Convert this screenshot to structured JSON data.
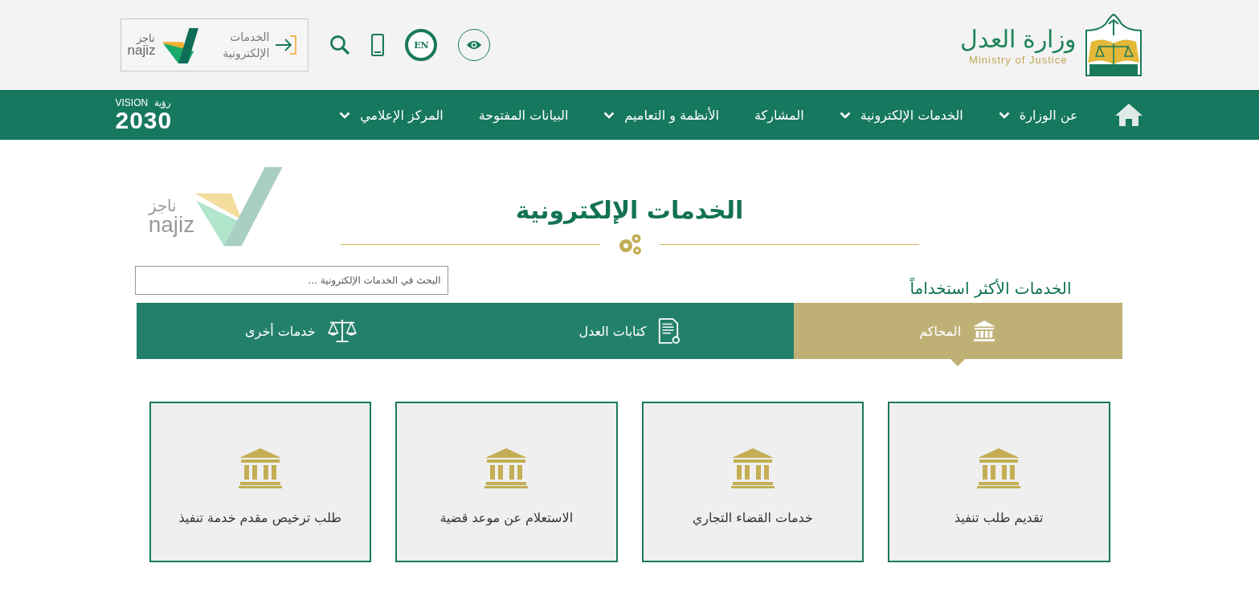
{
  "header": {
    "logo": {
      "arabic": "وزارة العدل",
      "english": "Ministry of Justice"
    },
    "language_button": {
      "label": "EN"
    },
    "najiz_link": {
      "label": "الخدمات الإلكترونية",
      "brand_arabic": "ناجز",
      "brand_latin": "najiz"
    }
  },
  "nav": {
    "items": [
      {
        "label": "عن الوزارة",
        "dropdown": true
      },
      {
        "label": "الخدمات الإلكترونية",
        "dropdown": true
      },
      {
        "label": "المشاركة",
        "dropdown": false
      },
      {
        "label": "الأنظمة و التعاميم",
        "dropdown": true
      },
      {
        "label": "البيانات المفتوحة",
        "dropdown": false
      },
      {
        "label": "المركز الإعلامي",
        "dropdown": true
      }
    ],
    "vision": {
      "label": "VISION",
      "arabic": "رؤية",
      "year": "2030"
    }
  },
  "hero": {
    "title": "الخدمات الإلكترونية",
    "faded_logo": {
      "brand_arabic": "ناجز",
      "brand_latin": "najiz"
    }
  },
  "section_title": "الخدمات الأكثر استخداماً",
  "search": {
    "placeholder": "البحث في الخدمات الإلكترونية ..."
  },
  "tabs": [
    {
      "label": "المحاكم",
      "kind": "court",
      "selected": true
    },
    {
      "label": "كتابات العدل",
      "kind": "document",
      "selected": false
    },
    {
      "label": "خدمات أخرى",
      "kind": "scales",
      "selected": false
    }
  ],
  "cards": [
    {
      "label": "تقديم طلب تنفيذ"
    },
    {
      "label": "خدمات القضاء التجاري"
    },
    {
      "label": "الاستعلام عن موعد قضية"
    },
    {
      "label": "طلب ترخيص مقدم خدمة تنفيذ"
    }
  ]
}
